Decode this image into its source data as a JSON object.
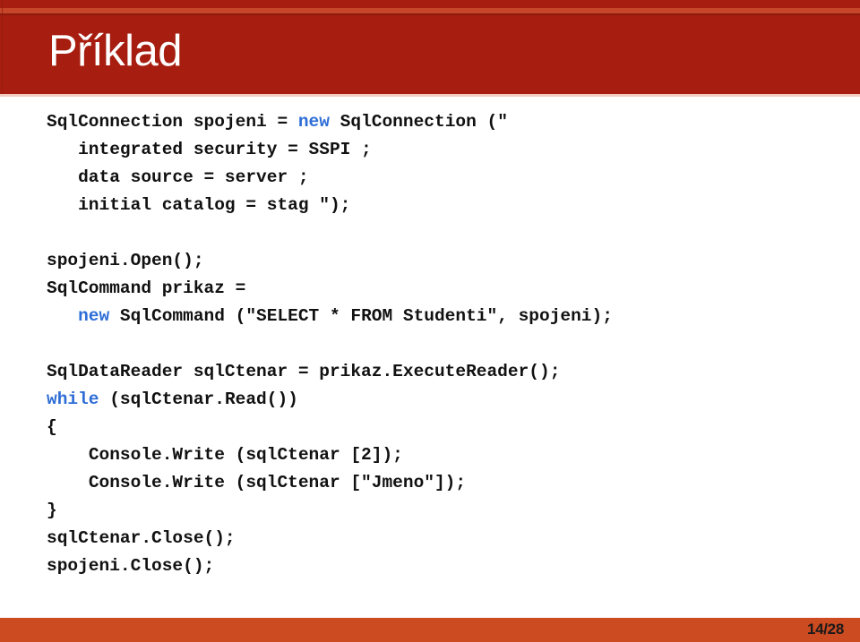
{
  "slide": {
    "title": "Příklad",
    "accent_color": "#A71E10",
    "accent_stripe_color": "#C6462A",
    "footer_color": "#CD4B20",
    "keyword_color": "#2E6DD6",
    "text_color": "#111111"
  },
  "code": {
    "language": "csharp",
    "lines": [
      {
        "indent": 0,
        "segments": [
          {
            "text": "SqlConnection spojeni = ",
            "kind": "plain"
          },
          {
            "text": "new",
            "kind": "keyword"
          },
          {
            "text": " SqlConnection (\"",
            "kind": "plain"
          }
        ]
      },
      {
        "indent": 3,
        "segments": [
          {
            "text": "integrated security = SSPI ;",
            "kind": "plain"
          }
        ]
      },
      {
        "indent": 3,
        "segments": [
          {
            "text": "data source = server ;",
            "kind": "plain"
          }
        ]
      },
      {
        "indent": 3,
        "segments": [
          {
            "text": "initial catalog = stag \");",
            "kind": "plain"
          }
        ]
      },
      {
        "indent": 0,
        "segments": []
      },
      {
        "indent": 0,
        "segments": [
          {
            "text": "spojeni.Open();",
            "kind": "plain"
          }
        ]
      },
      {
        "indent": 0,
        "segments": [
          {
            "text": "SqlCommand prikaz =",
            "kind": "plain"
          }
        ]
      },
      {
        "indent": 3,
        "segments": [
          {
            "text": "new",
            "kind": "keyword"
          },
          {
            "text": " SqlCommand (\"SELECT * FROM Studenti\", spojeni);",
            "kind": "plain"
          }
        ]
      },
      {
        "indent": 0,
        "segments": []
      },
      {
        "indent": 0,
        "segments": [
          {
            "text": "SqlDataReader sqlCtenar = prikaz.ExecuteReader();",
            "kind": "plain"
          }
        ]
      },
      {
        "indent": 0,
        "segments": [
          {
            "text": "while",
            "kind": "keyword"
          },
          {
            "text": " (sqlCtenar.Read())",
            "kind": "plain"
          }
        ]
      },
      {
        "indent": 0,
        "segments": [
          {
            "text": "{",
            "kind": "plain"
          }
        ]
      },
      {
        "indent": 4,
        "segments": [
          {
            "text": "Console.Write (sqlCtenar [2]);",
            "kind": "plain"
          }
        ]
      },
      {
        "indent": 4,
        "segments": [
          {
            "text": "Console.Write (sqlCtenar [\"Jmeno\"]);",
            "kind": "plain"
          }
        ]
      },
      {
        "indent": 0,
        "segments": [
          {
            "text": "}",
            "kind": "plain"
          }
        ]
      },
      {
        "indent": 0,
        "segments": [
          {
            "text": "sqlCtenar.Close();",
            "kind": "plain"
          }
        ]
      },
      {
        "indent": 0,
        "segments": [
          {
            "text": "spojeni.Close();",
            "kind": "plain"
          }
        ]
      }
    ]
  },
  "footer": {
    "page_indicator": "14/28",
    "current_page": 14,
    "total_pages": 28
  }
}
